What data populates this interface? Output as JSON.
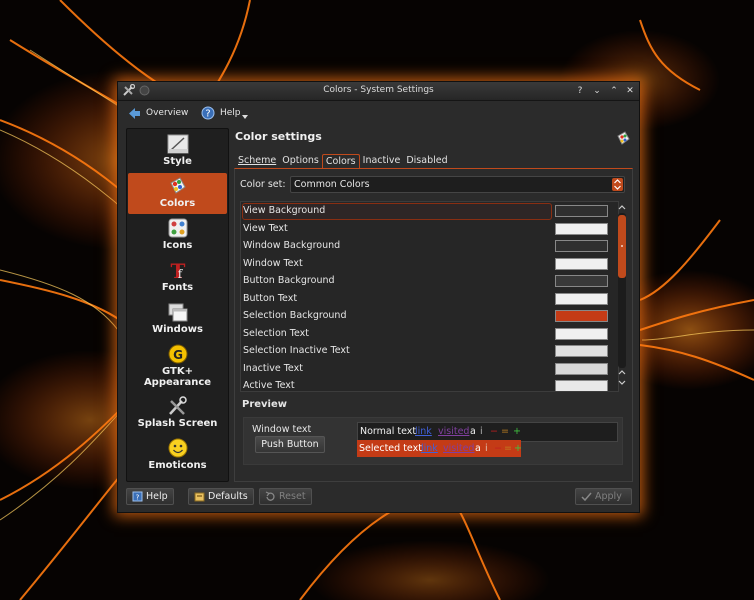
{
  "window": {
    "title": "Colors - System Settings",
    "controls": [
      "?",
      "⌄",
      "⌃",
      "✕"
    ]
  },
  "toolbar": {
    "overview_label": "Overview",
    "help_label": "Help"
  },
  "sidebar": {
    "items": [
      {
        "label": "Style",
        "icon": "style-icon"
      },
      {
        "label": "Colors",
        "icon": "colors-icon"
      },
      {
        "label": "Icons",
        "icon": "icons-icon"
      },
      {
        "label": "Fonts",
        "icon": "fonts-icon"
      },
      {
        "label": "Windows",
        "icon": "windows-icon"
      },
      {
        "label": "GTK+",
        "label2": "Appearance",
        "icon": "gtk-icon"
      },
      {
        "label": "Splash Screen",
        "icon": "splash-icon"
      },
      {
        "label": "Emoticons",
        "icon": "emoticons-icon"
      }
    ]
  },
  "main": {
    "heading": "Color settings",
    "tabs": [
      {
        "label": "Scheme"
      },
      {
        "label": "Options"
      },
      {
        "label": "Colors"
      },
      {
        "label": "Inactive"
      },
      {
        "label": "Disabled"
      }
    ],
    "color_set_label": "Color set:",
    "color_set_value": "Common Colors",
    "color_rows": [
      {
        "name": "View Background",
        "swatch": "#2f2f2f"
      },
      {
        "name": "View Text",
        "swatch": "#f0f0f0"
      },
      {
        "name": "Window Background",
        "swatch": "#2f2f2f"
      },
      {
        "name": "Window Text",
        "swatch": "#f0f0f0"
      },
      {
        "name": "Button Background",
        "swatch": "#393939"
      },
      {
        "name": "Button Text",
        "swatch": "#f0f0f0"
      },
      {
        "name": "Selection Background",
        "swatch": "#c43b16"
      },
      {
        "name": "Selection Text",
        "swatch": "#f0f0f0"
      },
      {
        "name": "Selection Inactive Text",
        "swatch": "#e0e0e0"
      },
      {
        "name": "Inactive Text",
        "swatch": "#d8d8d8"
      },
      {
        "name": "Active Text",
        "swatch": "#e8e8e8"
      }
    ],
    "preview": {
      "label": "Preview",
      "window_text": "Window text",
      "push_button": "Push Button",
      "normal_text": "Normal text",
      "selected_text": "Selected text",
      "link": "link",
      "visited": "visited",
      "a": "a",
      "i": "i",
      "minus": "−",
      "equals": "=",
      "plus": "+"
    }
  },
  "bottom": {
    "help_label": "Help",
    "defaults_label": "Defaults",
    "reset_label": "Reset",
    "apply_label": "Apply"
  },
  "colors": {
    "accent": "#c04a1c",
    "selection": "#c43b16",
    "link": "#4060d8",
    "visited": "#8040a0",
    "positive": "#40c040",
    "negative": "#c02020",
    "neutral": "#c08020"
  }
}
